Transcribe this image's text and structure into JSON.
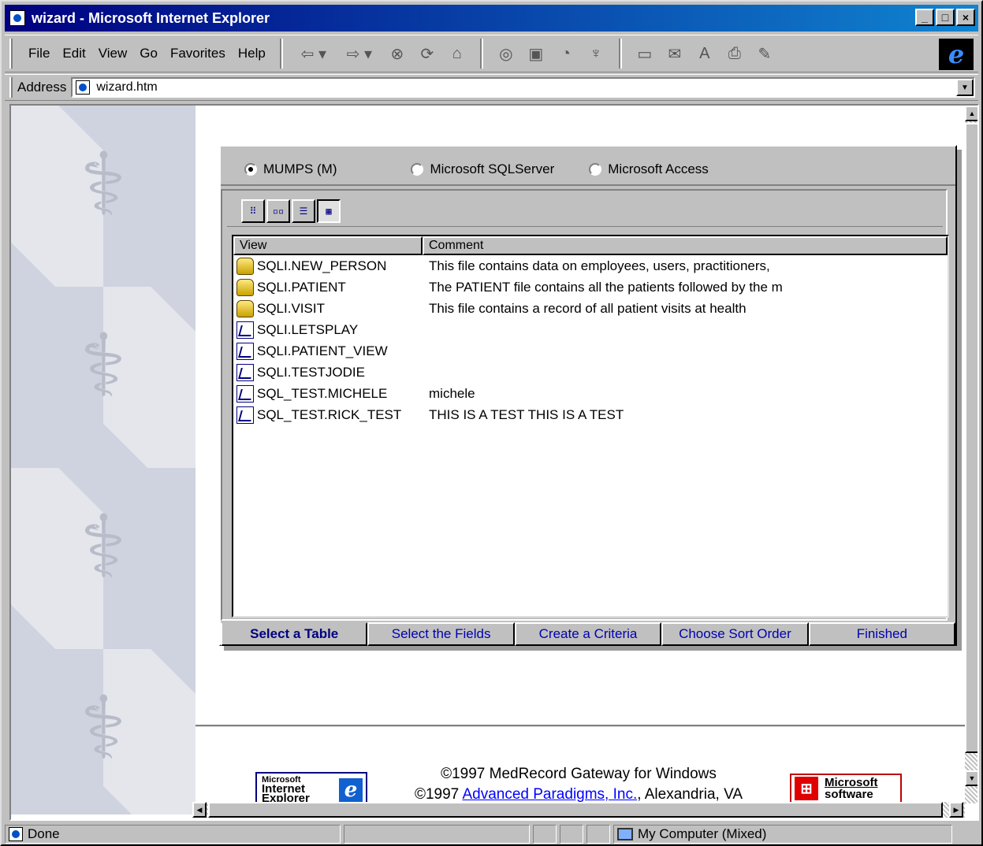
{
  "window": {
    "title": "wizard - Microsoft Internet Explorer",
    "min": "_",
    "max": "□",
    "close": "×"
  },
  "menu": [
    {
      "label": "File"
    },
    {
      "label": "Edit"
    },
    {
      "label": "View"
    },
    {
      "label": "Go"
    },
    {
      "label": "Favorites"
    },
    {
      "label": "Help"
    }
  ],
  "toolbar": {
    "back": "⇦ ▾",
    "forward": "⇨ ▾",
    "stop": "⊗",
    "refresh": "⟳",
    "home": "⌂",
    "search": "◎",
    "favorites": "▣",
    "history": "◔",
    "channels": "♆",
    "fullscreen": "▭",
    "mail": "✉",
    "font": "A",
    "print": "⎙",
    "edit": "✎",
    "logo": "e"
  },
  "address": {
    "label": "Address",
    "value": "wizard.htm",
    "dropdown": "▼"
  },
  "wizard": {
    "databases": [
      {
        "label": "MUMPS (M)",
        "selected": true
      },
      {
        "label": "Microsoft SQLServer",
        "selected": false
      },
      {
        "label": "Microsoft Access",
        "selected": false
      }
    ],
    "view_buttons": [
      {
        "name": "large-icons",
        "glyph": "⠿"
      },
      {
        "name": "small-icons",
        "glyph": "▫▫"
      },
      {
        "name": "list",
        "glyph": "☰"
      },
      {
        "name": "details",
        "glyph": "▦"
      }
    ],
    "columns": {
      "view": "View",
      "comment": "Comment"
    },
    "rows": [
      {
        "name": "SQLI.NEW_PERSON",
        "comment": "This file contains data on employees, users, practitioners,",
        "type": "table"
      },
      {
        "name": "SQLI.PATIENT",
        "comment": "The PATIENT file contains all the patients followed by the m",
        "type": "table"
      },
      {
        "name": "SQLI.VISIT",
        "comment": "This file contains a record of all patient visits at health",
        "type": "table"
      },
      {
        "name": "SQLI.LETSPLAY",
        "comment": "",
        "type": "view"
      },
      {
        "name": "SQLI.PATIENT_VIEW",
        "comment": "",
        "type": "view"
      },
      {
        "name": "SQLI.TESTJODIE",
        "comment": "",
        "type": "view"
      },
      {
        "name": "SQL_TEST.MICHELE",
        "comment": "michele",
        "type": "view"
      },
      {
        "name": "SQL_TEST.RICK_TEST",
        "comment": "THIS IS A TEST  THIS IS A TEST",
        "type": "view"
      }
    ],
    "tabs": [
      {
        "label": "Select a Table",
        "active": true
      },
      {
        "label": "Select the Fields",
        "active": false
      },
      {
        "label": "Create a Criteria",
        "active": false
      },
      {
        "label": "Choose Sort Order",
        "active": false
      },
      {
        "label": "Finished",
        "active": false
      }
    ]
  },
  "footer": {
    "ie_badge_line1": "Microsoft",
    "ie_badge_line2": "Internet",
    "ie_badge_line3": "Explorer",
    "line1": "©1997 MedRecord Gateway for Windows",
    "line2_prefix": "©1997 ",
    "line2_link": "Advanced Paradigms, Inc.",
    "line2_suffix": ", Alexandria, VA",
    "ms_badge_top": "Microsoft",
    "ms_badge_bottom": "software"
  },
  "status": {
    "text": "Done",
    "zone": "My Computer (Mixed)"
  },
  "colors": {
    "title_start": "#000080",
    "title_end": "#1084d0",
    "link": "#0000ff",
    "tab_text": "#0000b0"
  }
}
